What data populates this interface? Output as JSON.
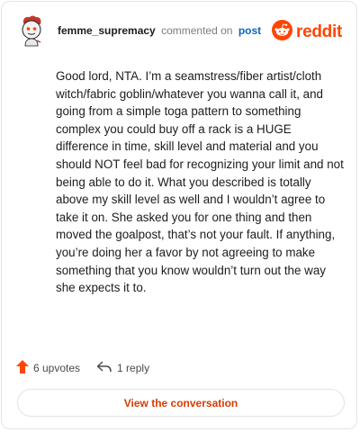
{
  "comment": {
    "username": "femme_supremacy",
    "action_text": "commented on",
    "post_link_text": "post",
    "body": "Good lord, NTA. I’m a seamstress/fiber artist/cloth witch/fabric goblin/whatever you wanna call it, and going from a simple toga pattern to something complex you could buy off a rack is a HUGE difference in time, skill level and material and you should NOT feel bad for recognizing your limit and not being able to do it. What you described is totally above my skill level as well and I wouldn’t agree to take it on. She asked you for one thing and then moved the goalpost, that’s not your fault. If anything, you’re doing her a favor by not agreeing to make something that you know wouldn’t turn out the way she expects it to."
  },
  "brand": {
    "name": "reddit",
    "icon": "reddit-snoo-icon",
    "color": "#ff4500"
  },
  "footer": {
    "upvotes_label": "6 upvotes",
    "upvote_icon": "upvote-arrow-icon",
    "upvote_color": "#ff4500",
    "replies_label": "1 reply",
    "reply_icon": "reply-arrow-icon"
  },
  "actions": {
    "view_conversation_label": "View the conversation",
    "accent_color": "#d93a00"
  },
  "avatar": {
    "icon": "user-avatar-icon"
  }
}
